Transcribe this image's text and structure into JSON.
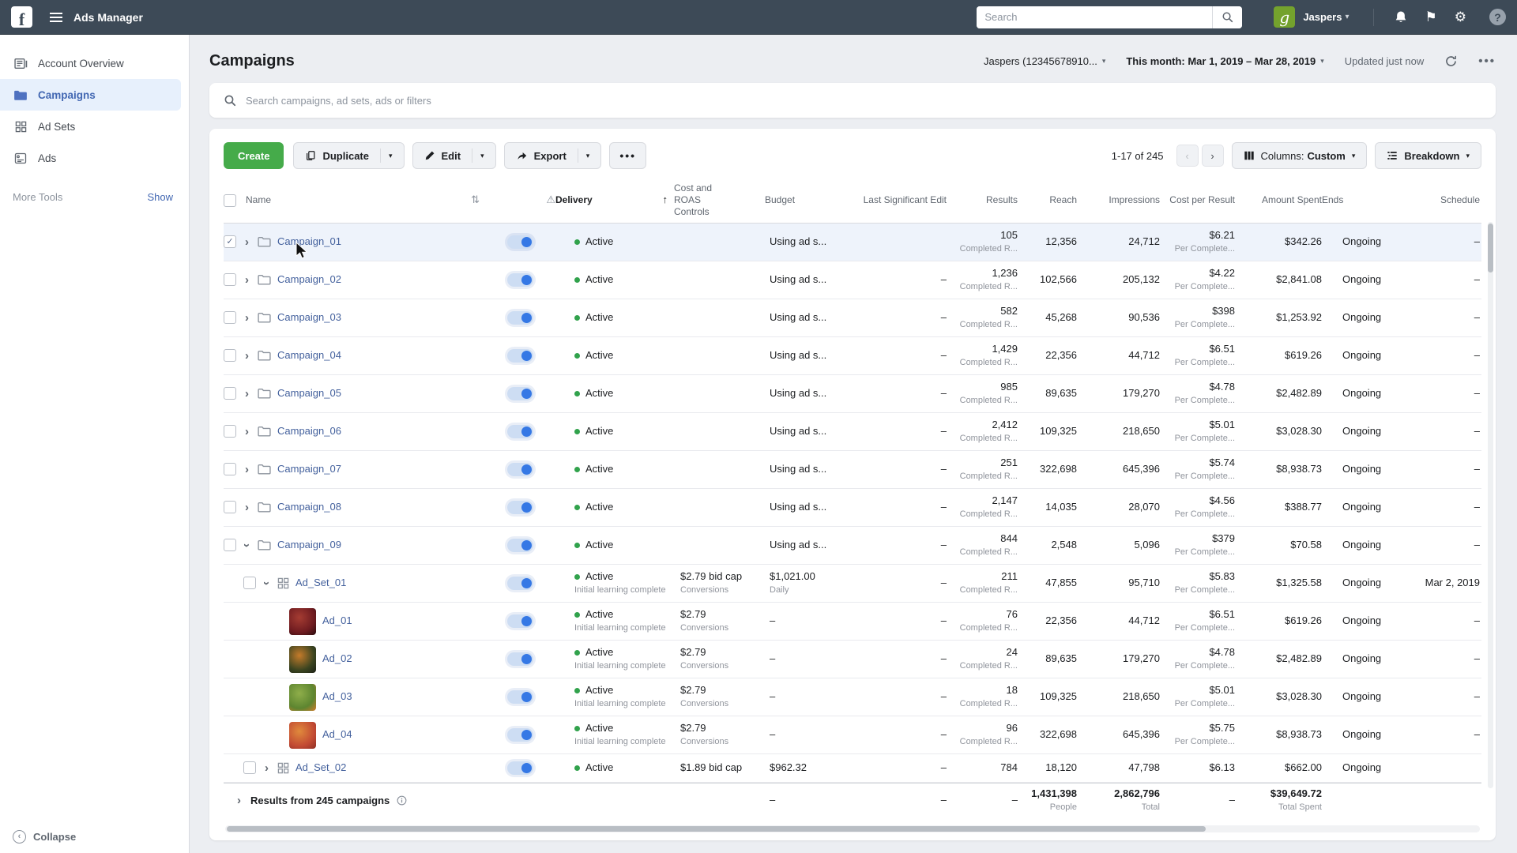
{
  "navbar": {
    "app_title": "Ads Manager",
    "search_placeholder": "Search",
    "user_name": "Jaspers",
    "avatar_letter": "g"
  },
  "sidebar": {
    "items": [
      {
        "label": "Account Overview",
        "icon": "account-overview-icon",
        "active": false
      },
      {
        "label": "Campaigns",
        "icon": "campaigns-folder-icon",
        "active": true
      },
      {
        "label": "Ad Sets",
        "icon": "ad-sets-grid-icon",
        "active": false
      },
      {
        "label": "Ads",
        "icon": "ads-icon",
        "active": false
      }
    ],
    "more_tools_label": "More Tools",
    "show_label": "Show",
    "collapse_label": "Collapse"
  },
  "header": {
    "title": "Campaigns",
    "account_selector": "Jaspers (12345678910...",
    "date_range": "This month: Mar 1, 2019 – Mar 28, 2019",
    "updated_status": "Updated just now"
  },
  "filter_search": {
    "placeholder": "Search campaigns, ad sets, ads or filters"
  },
  "toolbar": {
    "create_label": "Create",
    "duplicate_label": "Duplicate",
    "edit_label": "Edit",
    "export_label": "Export",
    "range_label": "1-17 of 245",
    "columns_prefix": "Columns:",
    "columns_value": "Custom",
    "breakdown_label": "Breakdown"
  },
  "table": {
    "headers": {
      "name": "Name",
      "delivery": "Delivery",
      "roas": "Cost and ROAS Controls",
      "budget": "Budget",
      "last_edit": "Last Significant Edit",
      "results": "Results",
      "reach": "Reach",
      "impressions": "Impressions",
      "cost_per_result": "Cost per Result",
      "amount_spent": "Amount Spent",
      "ends": "Ends",
      "schedule": "Schedule"
    },
    "rows": [
      {
        "type": "campaign",
        "name": "Campaign_01",
        "checked": true,
        "selected": true,
        "expanded": false,
        "delivery": "Active",
        "delivery_sub": "",
        "roas": "",
        "roas_sub": "",
        "budget": "Using ad s...",
        "budget_sub": "",
        "last_edit": "",
        "results": "105",
        "results_sub": "Completed R...",
        "reach": "12,356",
        "impressions": "24,712",
        "cost_per": "$6.21",
        "cost_per_sub": "Per Complete...",
        "amount": "$342.26",
        "ends": "Ongoing",
        "schedule": "–"
      },
      {
        "type": "campaign",
        "name": "Campaign_02",
        "checked": false,
        "selected": false,
        "expanded": false,
        "delivery": "Active",
        "delivery_sub": "",
        "roas": "",
        "roas_sub": "",
        "budget": "Using ad s...",
        "budget_sub": "",
        "last_edit": "–",
        "results": "1,236",
        "results_sub": "Completed R...",
        "reach": "102,566",
        "impressions": "205,132",
        "cost_per": "$4.22",
        "cost_per_sub": "Per Complete...",
        "amount": "$2,841.08",
        "ends": "Ongoing",
        "schedule": "–"
      },
      {
        "type": "campaign",
        "name": "Campaign_03",
        "checked": false,
        "selected": false,
        "expanded": false,
        "delivery": "Active",
        "delivery_sub": "",
        "roas": "",
        "roas_sub": "",
        "budget": "Using ad s...",
        "budget_sub": "",
        "last_edit": "–",
        "results": "582",
        "results_sub": "Completed R...",
        "reach": "45,268",
        "impressions": "90,536",
        "cost_per": "$398",
        "cost_per_sub": "Per Complete...",
        "amount": "$1,253.92",
        "ends": "Ongoing",
        "schedule": "–"
      },
      {
        "type": "campaign",
        "name": "Campaign_04",
        "checked": false,
        "selected": false,
        "expanded": false,
        "delivery": "Active",
        "delivery_sub": "",
        "roas": "",
        "roas_sub": "",
        "budget": "Using ad s...",
        "budget_sub": "",
        "last_edit": "–",
        "results": "1,429",
        "results_sub": "Completed R...",
        "reach": "22,356",
        "impressions": "44,712",
        "cost_per": "$6.51",
        "cost_per_sub": "Per Complete...",
        "amount": "$619.26",
        "ends": "Ongoing",
        "schedule": "–"
      },
      {
        "type": "campaign",
        "name": "Campaign_05",
        "checked": false,
        "selected": false,
        "expanded": false,
        "delivery": "Active",
        "delivery_sub": "",
        "roas": "",
        "roas_sub": "",
        "budget": "Using ad s...",
        "budget_sub": "",
        "last_edit": "–",
        "results": "985",
        "results_sub": "Completed R...",
        "reach": "89,635",
        "impressions": "179,270",
        "cost_per": "$4.78",
        "cost_per_sub": "Per Complete...",
        "amount": "$2,482.89",
        "ends": "Ongoing",
        "schedule": "–"
      },
      {
        "type": "campaign",
        "name": "Campaign_06",
        "checked": false,
        "selected": false,
        "expanded": false,
        "delivery": "Active",
        "delivery_sub": "",
        "roas": "",
        "roas_sub": "",
        "budget": "Using ad s...",
        "budget_sub": "",
        "last_edit": "–",
        "results": "2,412",
        "results_sub": "Completed R...",
        "reach": "109,325",
        "impressions": "218,650",
        "cost_per": "$5.01",
        "cost_per_sub": "Per Complete...",
        "amount": "$3,028.30",
        "ends": "Ongoing",
        "schedule": "–"
      },
      {
        "type": "campaign",
        "name": "Campaign_07",
        "checked": false,
        "selected": false,
        "expanded": false,
        "delivery": "Active",
        "delivery_sub": "",
        "roas": "",
        "roas_sub": "",
        "budget": "Using ad s...",
        "budget_sub": "",
        "last_edit": "–",
        "results": "251",
        "results_sub": "Completed R...",
        "reach": "322,698",
        "impressions": "645,396",
        "cost_per": "$5.74",
        "cost_per_sub": "Per Complete...",
        "amount": "$8,938.73",
        "ends": "Ongoing",
        "schedule": "–"
      },
      {
        "type": "campaign",
        "name": "Campaign_08",
        "checked": false,
        "selected": false,
        "expanded": false,
        "delivery": "Active",
        "delivery_sub": "",
        "roas": "",
        "roas_sub": "",
        "budget": "Using ad s...",
        "budget_sub": "",
        "last_edit": "–",
        "results": "2,147",
        "results_sub": "Completed R...",
        "reach": "14,035",
        "impressions": "28,070",
        "cost_per": "$4.56",
        "cost_per_sub": "Per Complete...",
        "amount": "$388.77",
        "ends": "Ongoing",
        "schedule": "–"
      },
      {
        "type": "campaign",
        "name": "Campaign_09",
        "checked": false,
        "selected": false,
        "expanded": true,
        "delivery": "Active",
        "delivery_sub": "",
        "roas": "",
        "roas_sub": "",
        "budget": "Using ad s...",
        "budget_sub": "",
        "last_edit": "–",
        "results": "844",
        "results_sub": "Completed R...",
        "reach": "2,548",
        "impressions": "5,096",
        "cost_per": "$379",
        "cost_per_sub": "Per Complete...",
        "amount": "$70.58",
        "ends": "Ongoing",
        "schedule": "–"
      },
      {
        "type": "adset",
        "name": "Ad_Set_01",
        "checked": false,
        "selected": false,
        "expanded": true,
        "delivery": "Active",
        "delivery_sub": "Initial learning complete",
        "roas": "$2.79 bid cap",
        "roas_sub": "Conversions",
        "budget": "$1,021.00",
        "budget_sub": "Daily",
        "last_edit": "–",
        "results": "211",
        "results_sub": "Completed R...",
        "reach": "47,855",
        "impressions": "95,710",
        "cost_per": "$5.83",
        "cost_per_sub": "Per Complete...",
        "amount": "$1,325.58",
        "ends": "Ongoing",
        "schedule": "Mar 2, 2019"
      },
      {
        "type": "ad",
        "name": "Ad_01",
        "thumb": [
          "#6e1b20",
          "#a53c32",
          "#2a0c0e"
        ],
        "delivery": "Active",
        "delivery_sub": "Initial learning complete",
        "roas": "$2.79",
        "roas_sub": "Conversions",
        "budget": "–",
        "budget_sub": "",
        "last_edit": "–",
        "results": "76",
        "results_sub": "Completed R...",
        "reach": "22,356",
        "impressions": "44,712",
        "cost_per": "$6.51",
        "cost_per_sub": "Per Complete...",
        "amount": "$619.26",
        "ends": "Ongoing",
        "schedule": "–"
      },
      {
        "type": "ad",
        "name": "Ad_02",
        "thumb": [
          "#3a4420",
          "#c57b2a",
          "#1c2016"
        ],
        "delivery": "Active",
        "delivery_sub": "Initial learning complete",
        "roas": "$2.79",
        "roas_sub": "Conversions",
        "budget": "–",
        "budget_sub": "",
        "last_edit": "–",
        "results": "24",
        "results_sub": "Completed R...",
        "reach": "89,635",
        "impressions": "179,270",
        "cost_per": "$4.78",
        "cost_per_sub": "Per Complete...",
        "amount": "$2,482.89",
        "ends": "Ongoing",
        "schedule": "–"
      },
      {
        "type": "ad",
        "name": "Ad_03",
        "thumb": [
          "#5d8530",
          "#8fae4a",
          "#d07c2c"
        ],
        "delivery": "Active",
        "delivery_sub": "Initial learning complete",
        "roas": "$2.79",
        "roas_sub": "Conversions",
        "budget": "–",
        "budget_sub": "",
        "last_edit": "–",
        "results": "18",
        "results_sub": "Completed R...",
        "reach": "109,325",
        "impressions": "218,650",
        "cost_per": "$5.01",
        "cost_per_sub": "Per Complete...",
        "amount": "$3,028.30",
        "ends": "Ongoing",
        "schedule": "–"
      },
      {
        "type": "ad",
        "name": "Ad_04",
        "thumb": [
          "#c24a33",
          "#e08a3c",
          "#8e2f25"
        ],
        "delivery": "Active",
        "delivery_sub": "Initial learning complete",
        "roas": "$2.79",
        "roas_sub": "Conversions",
        "budget": "–",
        "budget_sub": "",
        "last_edit": "–",
        "results": "96",
        "results_sub": "Completed R...",
        "reach": "322,698",
        "impressions": "645,396",
        "cost_per": "$5.75",
        "cost_per_sub": "Per Complete...",
        "amount": "$8,938.73",
        "ends": "Ongoing",
        "schedule": "–"
      },
      {
        "type": "adset",
        "name": "Ad_Set_02",
        "checked": false,
        "selected": false,
        "expanded": false,
        "short": true,
        "delivery": "Active",
        "delivery_sub": "",
        "roas": "$1.89 bid cap",
        "roas_sub": "",
        "budget": "$962.32",
        "budget_sub": "",
        "last_edit": "–",
        "results": "784",
        "results_sub": "",
        "reach": "18,120",
        "impressions": "47,798",
        "cost_per": "$6.13",
        "cost_per_sub": "",
        "amount": "$662.00",
        "ends": "Ongoing",
        "schedule": ""
      }
    ],
    "footer": {
      "label": "Results from 245 campaigns",
      "budget": "–",
      "last_edit": "–",
      "results": "–",
      "reach": "1,431,398",
      "reach_sub": "People",
      "impressions": "2,862,796",
      "impressions_sub": "Total",
      "cost_per": "–",
      "amount": "$39,649.72",
      "amount_sub": "Total Spent"
    }
  },
  "colors": {
    "navbar": "#3d4a57",
    "accent_blue": "#3578e5",
    "link_blue": "#44619d",
    "create_green": "#45ab4a",
    "active_dot_green": "#31a24c",
    "selected_row": "#eef3fb",
    "avatar_green": "#74a22d",
    "sidebar_active_bg": "#e7f0fc"
  }
}
